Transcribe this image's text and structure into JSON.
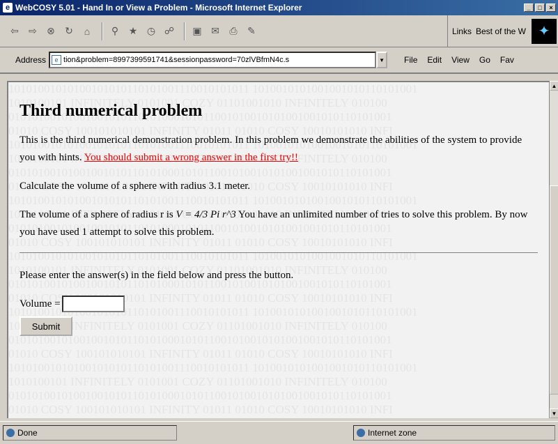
{
  "window": {
    "title": "WebCOSY 5.01 - Hand In or View a Problem - Microsoft Internet Explorer",
    "controls": [
      "_",
      "□",
      "×"
    ]
  },
  "toolbar": {
    "links_label": "Links",
    "best_link": "Best of the W"
  },
  "address": {
    "label": "Address",
    "url": "tion&problem=8997399591741&sessionpassword=70zlVBfmN4c.s"
  },
  "menu": [
    "File",
    "Edit",
    "View",
    "Go",
    "Fav"
  ],
  "page": {
    "title": "Third numerical problem",
    "intro": "This is the third numerical demonstration problem. In this problem we demonstrate the abilities of the system to provide you with hints.",
    "hint_link": "You should submit a wrong answer in the first try!!",
    "task": "Calculate the volume of a sphere with radius 3.1 meter.",
    "formula_prefix": "The volume of a sphere of radius r is ",
    "formula": "V = 4/3 Pi r^3",
    "formula_suffix": " You have an unlimited number of tries to solve this problem. By now you have used 1 attempt to solve this problem.",
    "instruction": "Please enter the answer(s) in the field below and press the button.",
    "volume_label": "Volume =",
    "volume_value": "",
    "submit_label": "Submit",
    "background_pattern": [
      "10101001010100101010110101001110010101011 1010010101001001010110101001",
      "1010100101 INFINITELY 0101001 COZY 01101001010 INFINITELY 010100",
      "01010100101001001010110101000101011001010010101001001010110101001",
      "01010 COSY 100101010101 INFINITY 01011 01010 COSY 10010101010 INFI"
    ]
  },
  "status": {
    "left": "Done",
    "zone": "Internet zone"
  }
}
